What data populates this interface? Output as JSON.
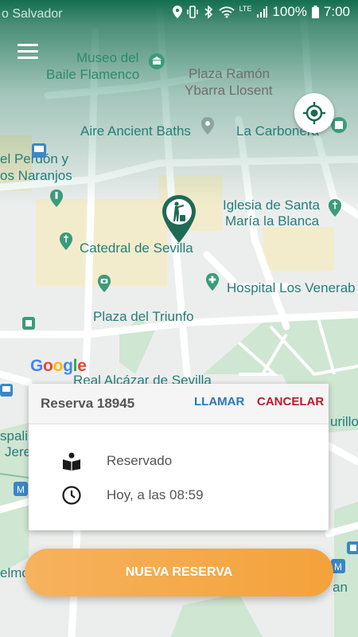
{
  "status_bar": {
    "battery": "100%",
    "time": "7:00",
    "network": "LTE"
  },
  "map": {
    "labels": {
      "top_left": "o Salvador",
      "museo_1": "Museo del",
      "museo_2": "Baile Flamenco",
      "plaza_ramon_1": "Plaza Ramón",
      "plaza_ramon_2": "Ybarra Llosent",
      "aire": "Aire Ancient Baths",
      "carbonera": "La Carbonera",
      "perdon_1": "el Perdón y",
      "perdon_2": "os Naranjos",
      "iglesia_1": "Iglesia de Santa",
      "iglesia_2": "María la Blanca",
      "catedral": "Catedral de Sevilla",
      "hospital": "Hospital Los Venerab",
      "plaza_triunfo": "Plaza del Triunfo",
      "alcazar": "Real Alcázar de Sevilla",
      "espali": "spali",
      "jere": "Jere",
      "murillo": "urillo",
      "elmo": "elmo",
      "an": "an"
    },
    "google_logo": "Google"
  },
  "card": {
    "title": "Reserva 18945",
    "call_label": "LLAMAR",
    "cancel_label": "CANCELAR",
    "status": "Reservado",
    "time": "Hoy, a las 08:59"
  },
  "new_reservation_label": "NUEVA RESERVA",
  "colors": {
    "accent_orange": "#f4a23a",
    "call_blue": "#2a78b8",
    "cancel_red": "#b21f2d",
    "pin_green": "#1e6a55"
  }
}
